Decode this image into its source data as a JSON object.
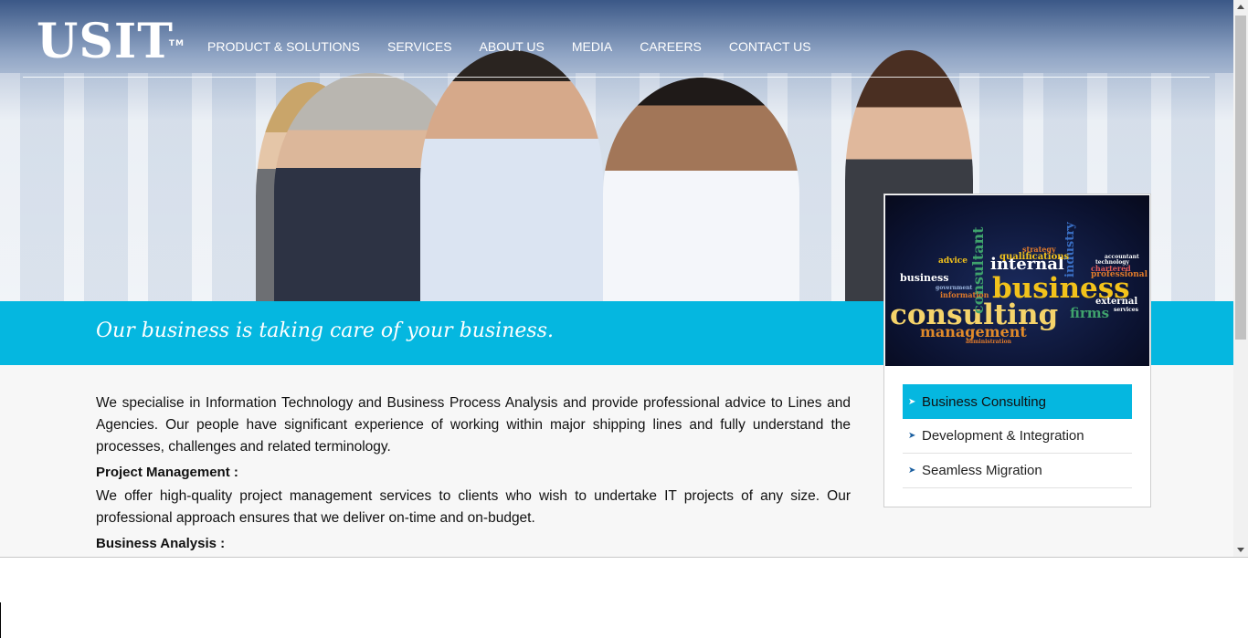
{
  "brand": {
    "logo": "USIT",
    "trademark": "TM"
  },
  "nav": [
    "PRODUCT & SOLUTIONS",
    "SERVICES",
    "ABOUT US",
    "MEDIA",
    "CAREERS",
    "CONTACT US"
  ],
  "tagline": "Our business is taking care of your business.",
  "content": {
    "intro": "We specialise in Information Technology and Business Process Analysis and provide professional advice to Lines and Agencies. Our people have significant experience of working within major shipping lines and fully understand the processes, challenges and related terminology.",
    "sections": [
      {
        "heading": "Project Management :",
        "text": "We offer high-quality project management services to clients who wish to undertake IT projects of any size. Our professional approach ensures that we deliver on-time and on-budget."
      },
      {
        "heading": "Business Analysis :"
      }
    ]
  },
  "sidebar": {
    "image_words": [
      "business",
      "consulting",
      "management",
      "internal",
      "consultant",
      "firms",
      "external",
      "industry",
      "qualifications",
      "professional",
      "advice",
      "business",
      "services",
      "strategy",
      "information",
      "chartered",
      "accountant",
      "technology",
      "government",
      "administration"
    ],
    "items": [
      "Business Consulting",
      "Development & Integration",
      "Seamless Migration"
    ],
    "active_index": 0
  },
  "colors": {
    "accent": "#05b7e0",
    "nav_text": "#ffffff"
  }
}
